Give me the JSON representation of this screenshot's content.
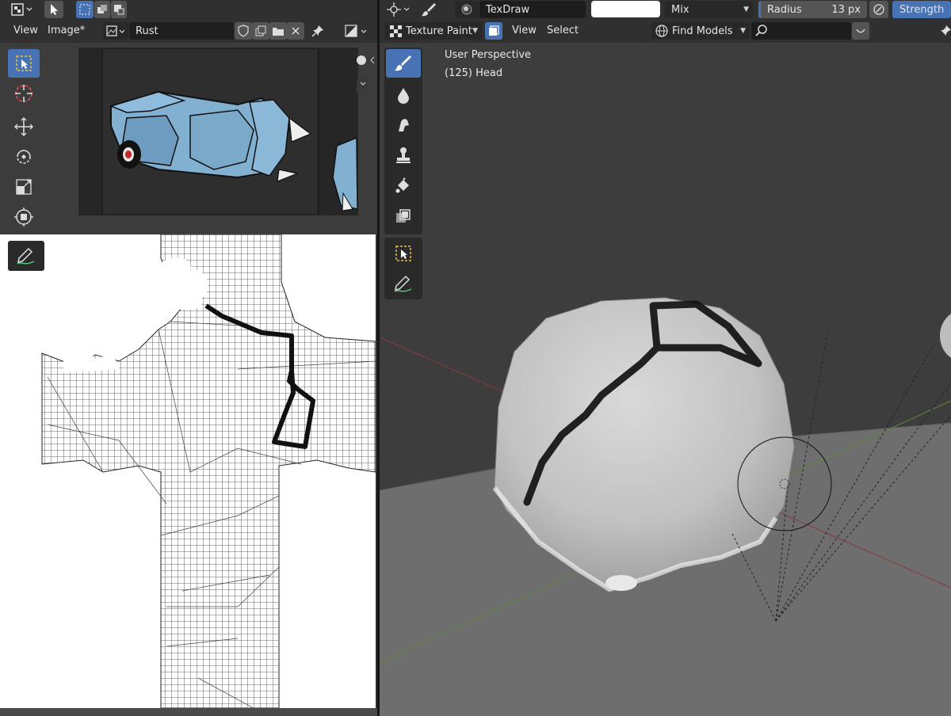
{
  "left_editor": {
    "header_menus": [
      "View",
      "Image*"
    ],
    "image_name": "Rust"
  },
  "right_editor": {
    "brush_name": "TexDraw",
    "blend_mode": "Mix",
    "radius_label": "Radius",
    "radius_value": "13 px",
    "strength_label": "Strength",
    "mode_label": "Texture Paint",
    "menus": [
      "View",
      "Select"
    ],
    "find_models_label": "Find Models",
    "search_value": "",
    "overlay_line1": "User Perspective",
    "overlay_line2": "(125) Head"
  },
  "colors": {
    "accent": "#4772b3",
    "panel_bg": "#303030",
    "field_bg": "#1d1d1d",
    "viewport_bg": "#3d3d3d",
    "brush_color": "#ffffff"
  }
}
